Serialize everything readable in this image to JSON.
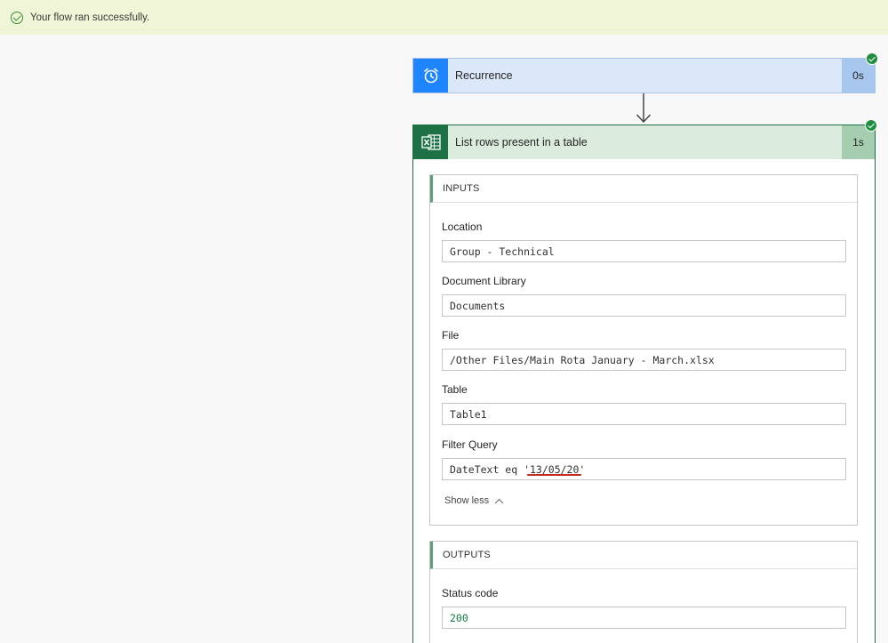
{
  "banner": {
    "message": "Your flow ran successfully.",
    "icon": "check-circle-icon",
    "color": "#eff5d6"
  },
  "recurrence": {
    "title": "Recurrence",
    "duration": "0s",
    "icon": "alarm-clock-icon",
    "color": "#1f85ff"
  },
  "list_rows": {
    "title": "List rows present in a table",
    "duration": "1s",
    "icon": "excel-icon",
    "color": "#1e7145",
    "inputs": {
      "header": "INPUTS",
      "fields": [
        {
          "label": "Location",
          "value": "Group - Technical"
        },
        {
          "label": "Document Library",
          "value": "Documents"
        },
        {
          "label": "File",
          "value": "/Other Files/Main Rota January - March.xlsx"
        },
        {
          "label": "Table",
          "value": "Table1"
        },
        {
          "label": "Filter Query",
          "value": "DateText eq '13/05/20'"
        }
      ],
      "show_less": "Show less"
    },
    "outputs": {
      "header": "OUTPUTS",
      "fields": [
        {
          "label": "Status code",
          "value": "200"
        }
      ]
    }
  }
}
